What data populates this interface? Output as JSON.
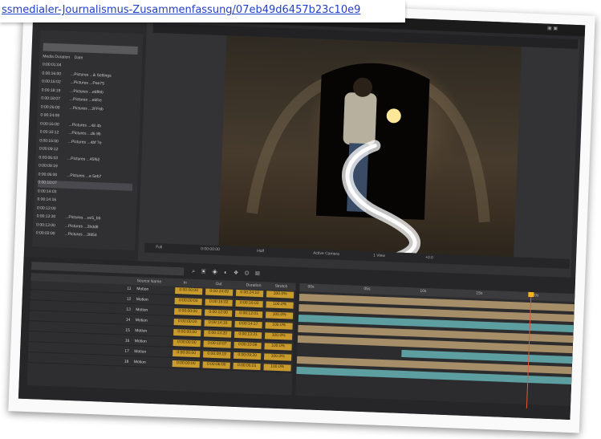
{
  "url": "ssmedialer-Journalismus-Zusammenfassung/07eb49d6457b23c10e9",
  "project_panel": {
    "columns": [
      "Media Duration",
      "Date"
    ],
    "rows": [
      {
        "dur": "0:00:01:04",
        "label": "",
        "selected": false
      },
      {
        "dur": "0:00:16:00",
        "label": "...Pictures ...& Settings",
        "selected": false
      },
      {
        "dur": "0:00:16:02",
        "label": "...Pictures ...Pee75",
        "selected": false
      },
      {
        "dur": "0:00:18:19",
        "label": "...Pictures ...e8ffeb",
        "selected": false
      },
      {
        "dur": "0:00:18:07",
        "label": "...Pictures ...e6fce",
        "selected": false
      },
      {
        "dur": "0:00:26:00",
        "label": "...Pictures ...2FF6b",
        "selected": false
      },
      {
        "dur": "0:00:24:09",
        "label": "",
        "selected": false
      },
      {
        "dur": "0:00:16:00",
        "label": "...Pictures ...48 4b",
        "selected": false
      },
      {
        "dur": "0:00:10:12",
        "label": "...Pictures ...d6 9b",
        "selected": false
      },
      {
        "dur": "0:00:16:00",
        "label": "...Pictures ...4bf 7e",
        "selected": false
      },
      {
        "dur": "0:00:09:12",
        "label": "",
        "selected": false
      },
      {
        "dur": "0:00:06:03",
        "label": "...Pictures ...45f62",
        "selected": false
      },
      {
        "dur": "0:00:09:19",
        "label": "",
        "selected": false
      },
      {
        "dur": "0:00:06:00",
        "label": "...Pictures ...e 5eb7",
        "selected": false
      },
      {
        "dur": "0:00:10:07",
        "label": "",
        "selected": true
      },
      {
        "dur": "0:00:14:03",
        "label": "",
        "selected": false
      },
      {
        "dur": "0:00:14:16",
        "label": "",
        "selected": false
      },
      {
        "dur": "0:00:12:00",
        "label": "",
        "selected": false
      },
      {
        "dur": "0:00:13:20",
        "label": "...Pictures ...ec5_bb",
        "selected": false
      },
      {
        "dur": "0:00:13:00",
        "label": "...Pictures ...2bdd8",
        "selected": false
      },
      {
        "dur": "0:00:02:00",
        "label": "...Pictures ...3fd54",
        "selected": false
      }
    ]
  },
  "viewer_toolbar": {
    "zoom": "Full",
    "timecode": "0:00:00:00",
    "quality": "Half",
    "view": "Active Camera",
    "views": "1 View",
    "extra": "+0.0"
  },
  "timeline": {
    "icons": [
      "search-icon",
      "comp-mini-icon",
      "draft-3d-icon",
      "hide-icon",
      "frame-blend-icon",
      "motion-blur-icon",
      "graph-icon"
    ],
    "icons_glyphs": "⌕ ▣ ◈ ◐ ❖ ◎ ▦",
    "headers": [
      "Source Name",
      "In",
      "Out",
      "Duration",
      "Stretch"
    ],
    "layers": [
      {
        "num": "11",
        "name": "Motion",
        "in": "0:00:00:00",
        "out": "0:00:24:09",
        "dur": "0:00:24:10",
        "stretch": "100.0%"
      },
      {
        "num": "12",
        "name": "Motion",
        "in": "0:00:00:00",
        "out": "0:00:16:02",
        "dur": "0:00:16:03",
        "stretch": "100.0%"
      },
      {
        "num": "13",
        "name": "Motion",
        "in": "0:00:00:00",
        "out": "0:00:12:00",
        "dur": "0:00:12:01",
        "stretch": "100.0%"
      },
      {
        "num": "14",
        "name": "Motion",
        "in": "0:00:00:00",
        "out": "0:00:14:16",
        "dur": "0:00:14:17",
        "stretch": "100.0%"
      },
      {
        "num": "15",
        "name": "Motion",
        "in": "0:00:00:00",
        "out": "0:00:13:20",
        "dur": "0:00:13:21",
        "stretch": "100.0%"
      },
      {
        "num": "16",
        "name": "Motion",
        "in": "0:00:00:00",
        "out": "0:00:10:07",
        "dur": "0:00:10:08",
        "stretch": "100.0%"
      },
      {
        "num": "17",
        "name": "Motion",
        "in": "0:00:00:00",
        "out": "0:00:09:19",
        "dur": "0:00:09:20",
        "stretch": "100.0%"
      },
      {
        "num": "18",
        "name": "Motion",
        "in": "0:00:00:00",
        "out": "0:00:06:00",
        "dur": "0:00:06:01",
        "stretch": "100.0%"
      }
    ],
    "ruler_ticks": [
      "00s",
      "05s",
      "10s",
      "15s",
      "20s"
    ],
    "colors": {
      "accent": "#c99a2c",
      "track_tan": "#a68e69",
      "track_teal": "#5d9fa0",
      "playhead": "#e25a38"
    }
  }
}
